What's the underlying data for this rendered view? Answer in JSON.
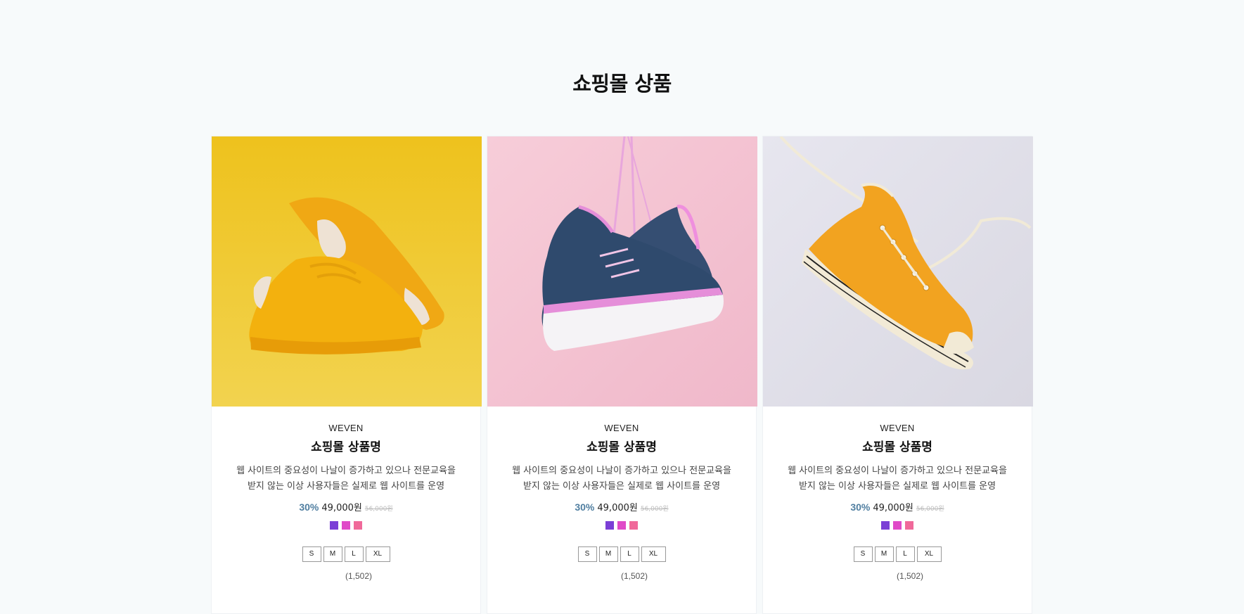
{
  "section": {
    "title": "쇼핑몰 상품"
  },
  "products": [
    {
      "image_alt": "yellow sneakers",
      "brand": "WEVEN",
      "name": "쇼핑몰 상품명",
      "desc_line1": "웹 사이트의 중요성이 나날이 증가하고 있으나 전문교육을",
      "desc_line2": "받지 않는 이상 사용자들은 실제로 웹 사이트를 운영",
      "discount": "30%",
      "price": "49,000원",
      "original_price": "56,000원",
      "colors": [
        "#7b3fd6",
        "#e04ac8",
        "#f0699a"
      ],
      "sizes": [
        "S",
        "M",
        "L",
        "XL"
      ],
      "reviews": "(1,502)"
    },
    {
      "image_alt": "navy sneakers hanging",
      "brand": "WEVEN",
      "name": "쇼핑몰 상품명",
      "desc_line1": "웹 사이트의 중요성이 나날이 증가하고 있으나 전문교육을",
      "desc_line2": "받지 않는 이상 사용자들은 실제로 웹 사이트를 운영",
      "discount": "30%",
      "price": "49,000원",
      "original_price": "56,000원",
      "colors": [
        "#7b3fd6",
        "#e04ac8",
        "#f0699a"
      ],
      "sizes": [
        "S",
        "M",
        "L",
        "XL"
      ],
      "reviews": "(1,502)"
    },
    {
      "image_alt": "orange high-top sneaker",
      "brand": "WEVEN",
      "name": "쇼핑몰 상품명",
      "desc_line1": "웹 사이트의 중요성이 나날이 증가하고 있으나 전문교육을",
      "desc_line2": "받지 않는 이상 사용자들은 실제로 웹 사이트를 운영",
      "discount": "30%",
      "price": "49,000원",
      "original_price": "56,000원",
      "colors": [
        "#7b3fd6",
        "#e04ac8",
        "#f0699a"
      ],
      "sizes": [
        "S",
        "M",
        "L",
        "XL"
      ],
      "reviews": "(1,502)"
    }
  ]
}
